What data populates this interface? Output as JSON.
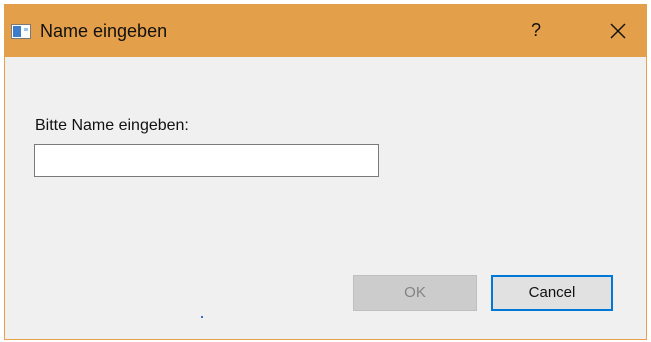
{
  "window": {
    "title": "Name eingeben",
    "help_label": "?",
    "icons": {
      "app": "app-window-icon",
      "close": "close-icon"
    }
  },
  "dialog": {
    "prompt": "Bitte Name eingeben:",
    "input_value": "",
    "ok_label": "OK",
    "ok_enabled": false,
    "cancel_label": "Cancel"
  },
  "colors": {
    "titlebar": "#e49f4a",
    "body": "#f0f0f0",
    "focus_border": "#0078d7"
  }
}
